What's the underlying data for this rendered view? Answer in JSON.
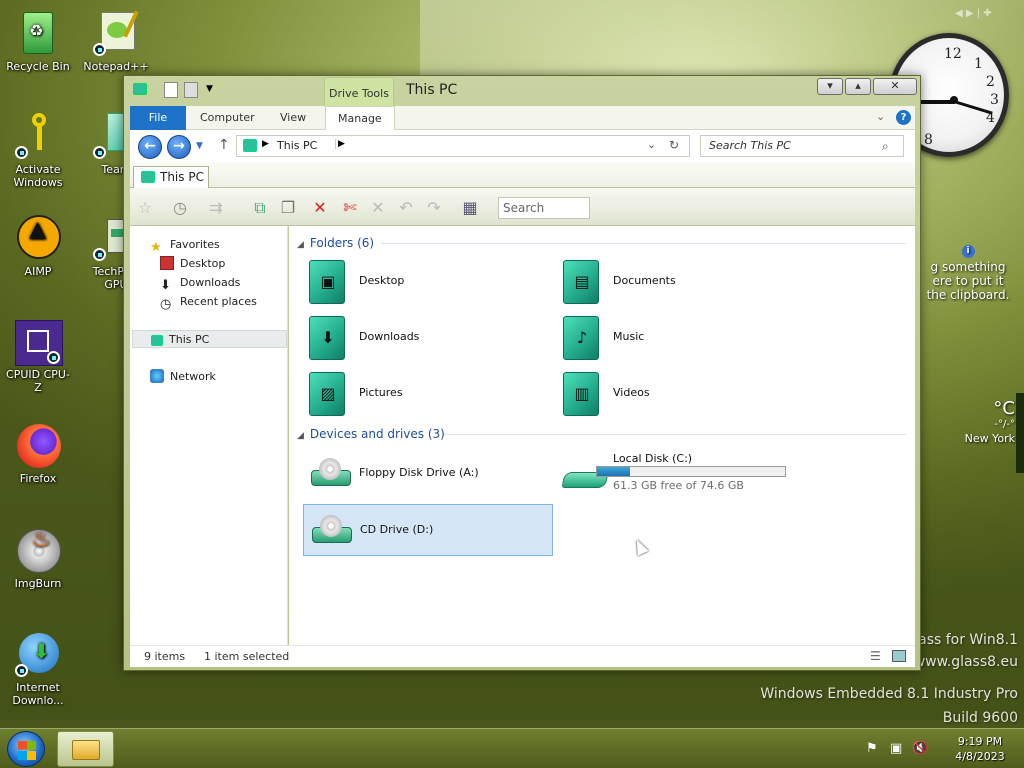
{
  "desktop": {
    "icons": [
      {
        "label": "Recycle Bin",
        "icon": "recycle-bin-icon"
      },
      {
        "label": "Notepad++",
        "icon": "notepad-plus-plus-icon"
      },
      {
        "label": "Activate Windows",
        "icon": "key-icon"
      },
      {
        "label": "Team",
        "icon": "team-icon"
      },
      {
        "label": "AIMP",
        "icon": "aimp-icon"
      },
      {
        "label": "TechPow GPU",
        "icon": "gpu-icon"
      },
      {
        "label": "CPUID CPU-Z",
        "icon": "cpuz-icon"
      },
      {
        "label": "Firefox",
        "icon": "firefox-icon"
      },
      {
        "label": "ImgBurn",
        "icon": "imgburn-icon"
      },
      {
        "label": "Internet Downlo...",
        "icon": "idm-icon"
      }
    ],
    "clipboard_gadget": {
      "line1": "g something",
      "line2": "ere to put it",
      "line3": "the clipboard."
    },
    "weather_gadget": {
      "unit": "°C",
      "dash": "-°/-°",
      "city": "New York"
    },
    "brand_lines": [
      "lass for Win8.1",
      "www.glass8.eu",
      "Windows Embedded 8.1 Industry Pro",
      "Build 9600"
    ]
  },
  "window": {
    "title": "This PC",
    "contextual_tab": "Drive Tools",
    "ribbon_tabs": {
      "file": "File",
      "computer": "Computer",
      "view": "View",
      "manage": "Manage"
    },
    "address": {
      "crumb": "This PC"
    },
    "search": {
      "placeholder": "Search This PC"
    },
    "folder_tab": "This PC",
    "toolbar_search": "Search",
    "nav": {
      "favorites": "Favorites",
      "desktop": "Desktop",
      "downloads": "Downloads",
      "recent": "Recent places",
      "this_pc": "This PC",
      "network": "Network"
    },
    "groups": {
      "folders": "Folders (6)",
      "devices": "Devices and drives (3)"
    },
    "folders": [
      "Desktop",
      "Documents",
      "Downloads",
      "Music",
      "Pictures",
      "Videos"
    ],
    "drives": {
      "floppy": "Floppy Disk Drive (A:)",
      "local": "Local Disk (C:)",
      "local_free": "61.3 GB free of 74.6 GB",
      "local_used_fraction": 0.178,
      "cd": "CD Drive (D:)"
    },
    "status": {
      "items": "9 items",
      "selected": "1 item selected"
    }
  },
  "taskbar": {
    "time": "9:19 PM",
    "date": "4/8/2023"
  }
}
